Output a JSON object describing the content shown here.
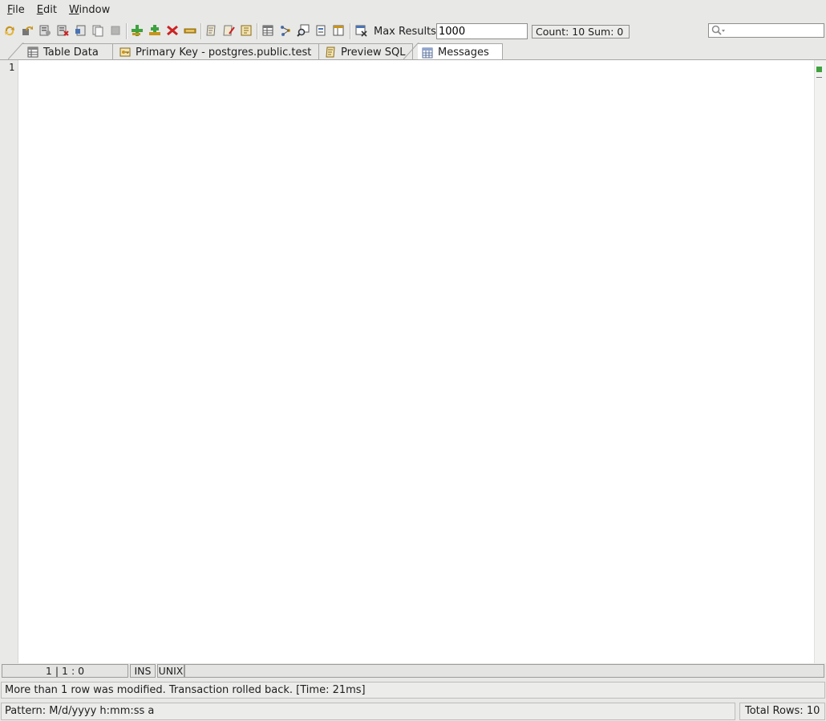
{
  "menu": [
    {
      "label": "File",
      "mnemonic": "F",
      "rest": "ile"
    },
    {
      "label": "Edit",
      "mnemonic": "E",
      "rest": "dit"
    },
    {
      "label": "Window",
      "mnemonic": "W",
      "rest": "indow"
    }
  ],
  "toolbar": {
    "max_results_label": "Max Results:",
    "max_results_value": "1000",
    "count_sum": "Count: 10  Sum: 0",
    "search_placeholder": ""
  },
  "tabs": [
    {
      "label": "Table Data",
      "icon": "table-icon",
      "active": false
    },
    {
      "label": "Primary Key - postgres.public.test",
      "icon": "key-icon",
      "active": false
    },
    {
      "label": "Preview SQL",
      "icon": "sql-script-icon",
      "active": false
    },
    {
      "label": "Messages",
      "icon": "grid-icon",
      "active": true
    }
  ],
  "editor": {
    "line_number": "1",
    "content": ""
  },
  "editor_status": {
    "position": "1 | 1 : 0",
    "mode": "INS",
    "line_ending": "UNIX"
  },
  "message": "More than 1 row was modified. Transaction rolled back. [Time: 21ms]",
  "status": {
    "pattern": "Pattern: M/d/yyyy h:mm:ss a",
    "total_rows": "Total Rows: 10"
  },
  "colors": {
    "accent_green": "#3fa13f",
    "icon_red": "#cc2222",
    "icon_gold": "#c89419"
  }
}
